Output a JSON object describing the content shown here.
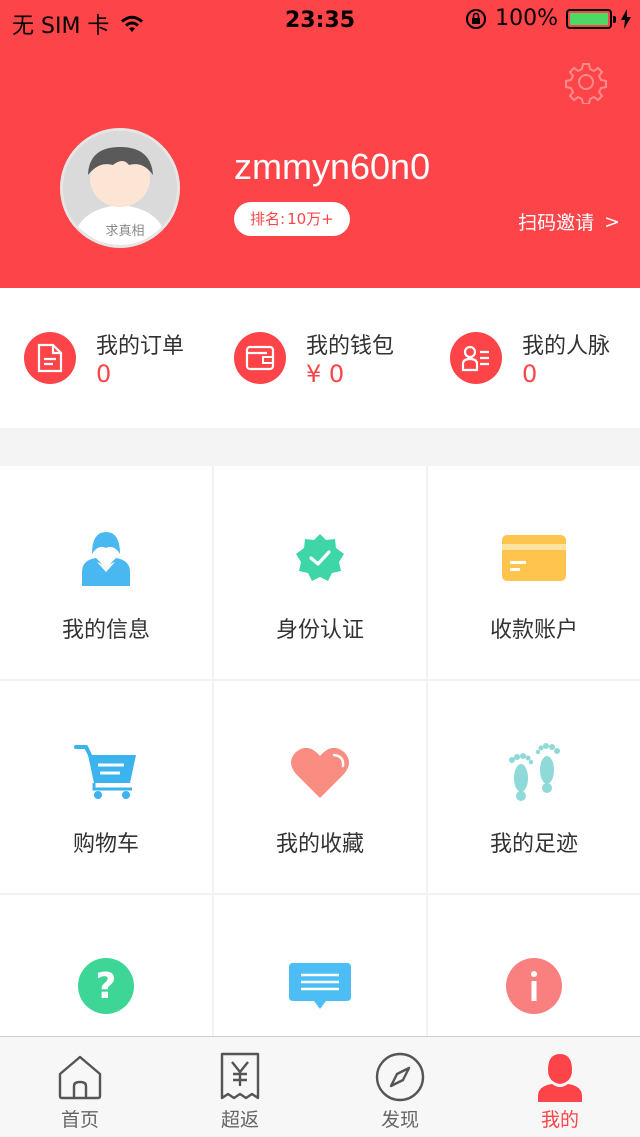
{
  "status_bar": {
    "carrier": "无 SIM 卡",
    "time": "23:35",
    "battery": "100%",
    "battery_level": 1.0
  },
  "profile": {
    "username": "zmmyn60n0",
    "rank_label": "排名:",
    "rank_value": "10万+",
    "invite_label": "扫码邀请",
    "invite_chevron": ">",
    "avatar_watermark": "求真相",
    "settings_icon": "gear-icon"
  },
  "stats": [
    {
      "label": "我的订单",
      "value": "0",
      "icon": "document-icon"
    },
    {
      "label": "我的钱包",
      "value": "¥ 0",
      "icon": "wallet-icon"
    },
    {
      "label": "我的人脉",
      "value": "0",
      "icon": "contacts-icon"
    }
  ],
  "grid": [
    {
      "label": "我的信息",
      "icon": "user-info-icon",
      "color": "#4ab8f0"
    },
    {
      "label": "身份认证",
      "icon": "verified-badge-icon",
      "color": "#3ed6a7"
    },
    {
      "label": "收款账户",
      "icon": "bank-card-icon",
      "color": "#ffc44d"
    },
    {
      "label": "购物车",
      "icon": "cart-icon",
      "color": "#3ab3ef"
    },
    {
      "label": "我的收藏",
      "icon": "heart-icon",
      "color": "#fa8c82"
    },
    {
      "label": "我的足迹",
      "icon": "footprints-icon",
      "color": "#8fd9d9"
    },
    {
      "label": "",
      "icon": "question-icon",
      "color": "#3ed696"
    },
    {
      "label": "",
      "icon": "message-icon",
      "color": "#4dbdf5"
    },
    {
      "label": "",
      "icon": "info-icon",
      "color": "#fa8080"
    }
  ],
  "tabbar": [
    {
      "label": "首页",
      "icon": "home-icon"
    },
    {
      "label": "超返",
      "icon": "receipt-yen-icon"
    },
    {
      "label": "发现",
      "icon": "compass-icon"
    },
    {
      "label": "我的",
      "icon": "person-icon"
    }
  ],
  "colors": {
    "brand_red": "#fd4448",
    "tab_active": "#fd4448",
    "tab_inactive": "#666666"
  }
}
